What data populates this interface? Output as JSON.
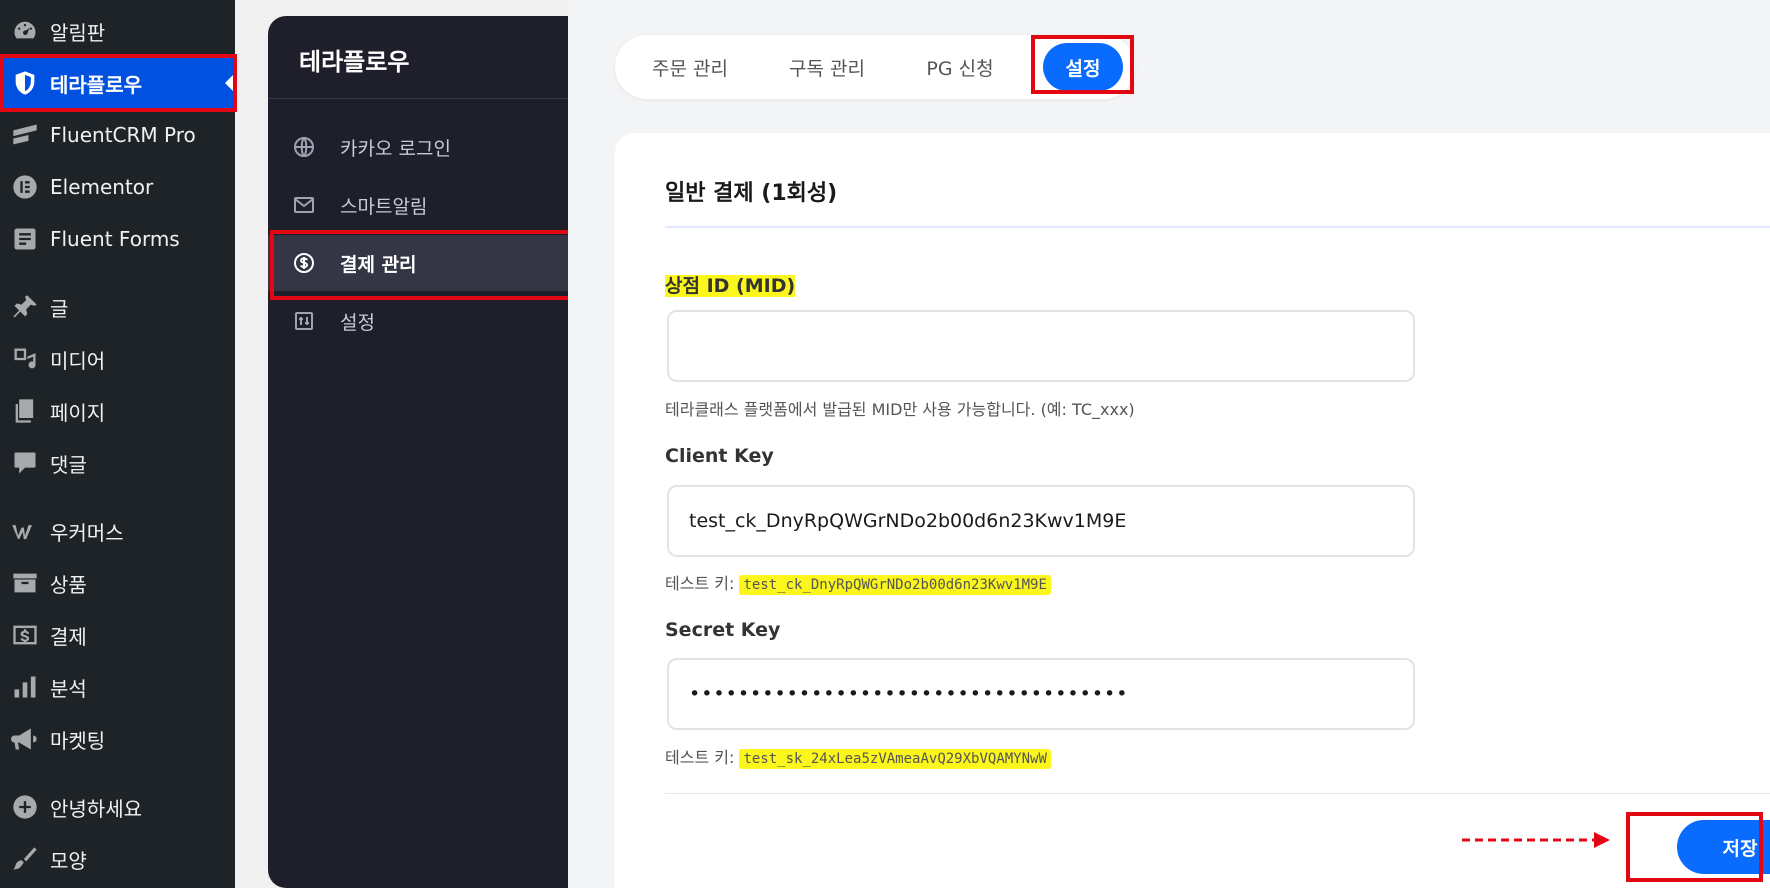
{
  "wp_sidebar": {
    "items": [
      {
        "label": "알림판",
        "icon": "dashboard-icon"
      },
      {
        "label": "테라플로우",
        "icon": "shield-icon"
      },
      {
        "label": "FluentCRM Pro",
        "icon": "fluentcrm-icon"
      },
      {
        "label": "Elementor",
        "icon": "elementor-icon"
      },
      {
        "label": "Fluent Forms",
        "icon": "forms-icon"
      },
      {
        "label": "글",
        "icon": "pin-icon"
      },
      {
        "label": "미디어",
        "icon": "media-icon"
      },
      {
        "label": "페이지",
        "icon": "page-icon"
      },
      {
        "label": "댓글",
        "icon": "comment-icon"
      },
      {
        "label": "우커머스",
        "icon": "woocommerce-icon"
      },
      {
        "label": "상품",
        "icon": "archive-icon"
      },
      {
        "label": "결제",
        "icon": "dollar-icon"
      },
      {
        "label": "분석",
        "icon": "chart-icon"
      },
      {
        "label": "마켓팅",
        "icon": "megaphone-icon"
      },
      {
        "label": "안녕하세요",
        "icon": "plus-icon"
      },
      {
        "label": "모양",
        "icon": "brush-icon"
      }
    ]
  },
  "plugin_sidebar": {
    "title": "테라플로우",
    "items": [
      {
        "label": "카카오 로그인",
        "icon": "globe-icon"
      },
      {
        "label": "스마트알림",
        "icon": "mail-icon"
      },
      {
        "label": "결제 관리",
        "icon": "dollar-circle-icon"
      },
      {
        "label": "설정",
        "icon": "settings-icon"
      }
    ]
  },
  "tabs": [
    {
      "label": "주문 관리"
    },
    {
      "label": "구독 관리"
    },
    {
      "label": "PG 신청"
    },
    {
      "label": "설정"
    }
  ],
  "form": {
    "section_title": "일반 결제 (1회성)",
    "mid": {
      "label": "상점 ID (MID)",
      "value": "",
      "help": "테라클래스 플랫폼에서 발급된 MID만 사용 가능합니다. (예: TC_xxx)"
    },
    "client_key": {
      "label": "Client Key",
      "value": "test_ck_DnyRpQWGrNDo2b00d6n23Kwv1M9E",
      "help_prefix": "테스트 키:",
      "help_code": "test_ck_DnyRpQWGrNDo2b00d6n23Kwv1M9E"
    },
    "secret_key": {
      "label": "Secret Key",
      "value": "••••••••••••••••••••••••••••••••••••",
      "help_prefix": "테스트 키:",
      "help_code": "test_sk_24xLea5zVAmeaAvQ29XbVQAMYNwW"
    },
    "save_label": "저장"
  },
  "colors": {
    "accent": "#0a6cff",
    "wp_active": "#0051e0",
    "highlight_box": "#e30613",
    "marker": "#fbf61b"
  }
}
